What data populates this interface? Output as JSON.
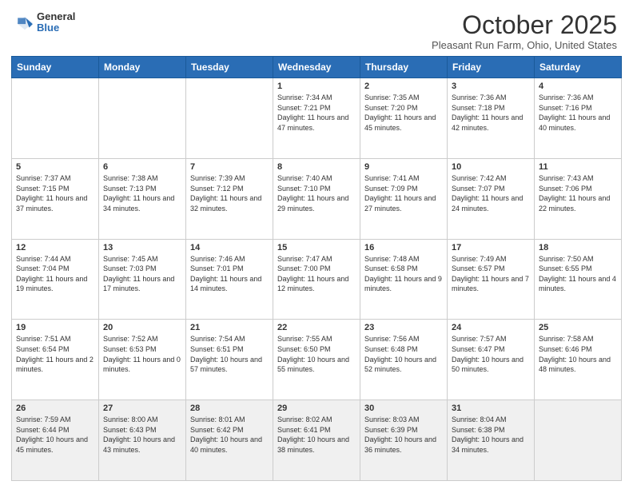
{
  "logo": {
    "general": "General",
    "blue": "Blue"
  },
  "header": {
    "title": "October 2025",
    "subtitle": "Pleasant Run Farm, Ohio, United States"
  },
  "weekdays": [
    "Sunday",
    "Monday",
    "Tuesday",
    "Wednesday",
    "Thursday",
    "Friday",
    "Saturday"
  ],
  "weeks": [
    [
      {
        "day": "",
        "info": ""
      },
      {
        "day": "",
        "info": ""
      },
      {
        "day": "",
        "info": ""
      },
      {
        "day": "1",
        "info": "Sunrise: 7:34 AM\nSunset: 7:21 PM\nDaylight: 11 hours and 47 minutes."
      },
      {
        "day": "2",
        "info": "Sunrise: 7:35 AM\nSunset: 7:20 PM\nDaylight: 11 hours and 45 minutes."
      },
      {
        "day": "3",
        "info": "Sunrise: 7:36 AM\nSunset: 7:18 PM\nDaylight: 11 hours and 42 minutes."
      },
      {
        "day": "4",
        "info": "Sunrise: 7:36 AM\nSunset: 7:16 PM\nDaylight: 11 hours and 40 minutes."
      }
    ],
    [
      {
        "day": "5",
        "info": "Sunrise: 7:37 AM\nSunset: 7:15 PM\nDaylight: 11 hours and 37 minutes."
      },
      {
        "day": "6",
        "info": "Sunrise: 7:38 AM\nSunset: 7:13 PM\nDaylight: 11 hours and 34 minutes."
      },
      {
        "day": "7",
        "info": "Sunrise: 7:39 AM\nSunset: 7:12 PM\nDaylight: 11 hours and 32 minutes."
      },
      {
        "day": "8",
        "info": "Sunrise: 7:40 AM\nSunset: 7:10 PM\nDaylight: 11 hours and 29 minutes."
      },
      {
        "day": "9",
        "info": "Sunrise: 7:41 AM\nSunset: 7:09 PM\nDaylight: 11 hours and 27 minutes."
      },
      {
        "day": "10",
        "info": "Sunrise: 7:42 AM\nSunset: 7:07 PM\nDaylight: 11 hours and 24 minutes."
      },
      {
        "day": "11",
        "info": "Sunrise: 7:43 AM\nSunset: 7:06 PM\nDaylight: 11 hours and 22 minutes."
      }
    ],
    [
      {
        "day": "12",
        "info": "Sunrise: 7:44 AM\nSunset: 7:04 PM\nDaylight: 11 hours and 19 minutes."
      },
      {
        "day": "13",
        "info": "Sunrise: 7:45 AM\nSunset: 7:03 PM\nDaylight: 11 hours and 17 minutes."
      },
      {
        "day": "14",
        "info": "Sunrise: 7:46 AM\nSunset: 7:01 PM\nDaylight: 11 hours and 14 minutes."
      },
      {
        "day": "15",
        "info": "Sunrise: 7:47 AM\nSunset: 7:00 PM\nDaylight: 11 hours and 12 minutes."
      },
      {
        "day": "16",
        "info": "Sunrise: 7:48 AM\nSunset: 6:58 PM\nDaylight: 11 hours and 9 minutes."
      },
      {
        "day": "17",
        "info": "Sunrise: 7:49 AM\nSunset: 6:57 PM\nDaylight: 11 hours and 7 minutes."
      },
      {
        "day": "18",
        "info": "Sunrise: 7:50 AM\nSunset: 6:55 PM\nDaylight: 11 hours and 4 minutes."
      }
    ],
    [
      {
        "day": "19",
        "info": "Sunrise: 7:51 AM\nSunset: 6:54 PM\nDaylight: 11 hours and 2 minutes."
      },
      {
        "day": "20",
        "info": "Sunrise: 7:52 AM\nSunset: 6:53 PM\nDaylight: 11 hours and 0 minutes."
      },
      {
        "day": "21",
        "info": "Sunrise: 7:54 AM\nSunset: 6:51 PM\nDaylight: 10 hours and 57 minutes."
      },
      {
        "day": "22",
        "info": "Sunrise: 7:55 AM\nSunset: 6:50 PM\nDaylight: 10 hours and 55 minutes."
      },
      {
        "day": "23",
        "info": "Sunrise: 7:56 AM\nSunset: 6:48 PM\nDaylight: 10 hours and 52 minutes."
      },
      {
        "day": "24",
        "info": "Sunrise: 7:57 AM\nSunset: 6:47 PM\nDaylight: 10 hours and 50 minutes."
      },
      {
        "day": "25",
        "info": "Sunrise: 7:58 AM\nSunset: 6:46 PM\nDaylight: 10 hours and 48 minutes."
      }
    ],
    [
      {
        "day": "26",
        "info": "Sunrise: 7:59 AM\nSunset: 6:44 PM\nDaylight: 10 hours and 45 minutes."
      },
      {
        "day": "27",
        "info": "Sunrise: 8:00 AM\nSunset: 6:43 PM\nDaylight: 10 hours and 43 minutes."
      },
      {
        "day": "28",
        "info": "Sunrise: 8:01 AM\nSunset: 6:42 PM\nDaylight: 10 hours and 40 minutes."
      },
      {
        "day": "29",
        "info": "Sunrise: 8:02 AM\nSunset: 6:41 PM\nDaylight: 10 hours and 38 minutes."
      },
      {
        "day": "30",
        "info": "Sunrise: 8:03 AM\nSunset: 6:39 PM\nDaylight: 10 hours and 36 minutes."
      },
      {
        "day": "31",
        "info": "Sunrise: 8:04 AM\nSunset: 6:38 PM\nDaylight: 10 hours and 34 minutes."
      },
      {
        "day": "",
        "info": ""
      }
    ]
  ]
}
